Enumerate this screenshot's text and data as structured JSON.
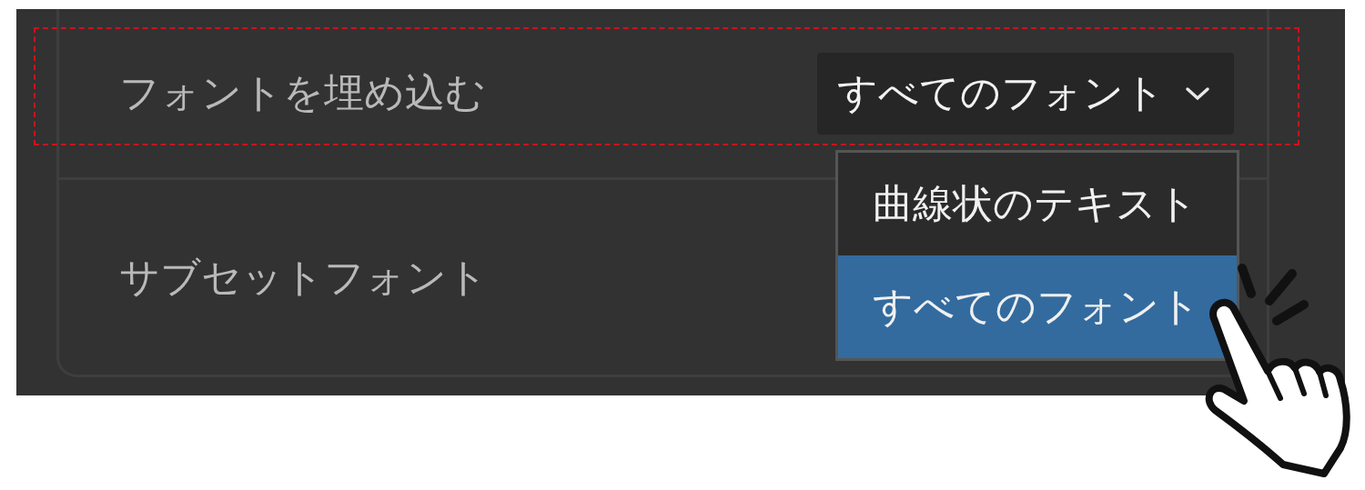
{
  "settings": [
    {
      "kind": "dropdown",
      "label": "フォントを埋め込む",
      "value": "すべてのフォント",
      "highlighted": true
    },
    {
      "kind": "plain",
      "label": "サブセットフォント"
    }
  ],
  "menu": {
    "items": [
      {
        "label": "曲線状のテキスト",
        "selected": false
      },
      {
        "label": "すべてのフォント",
        "selected": true
      }
    ]
  }
}
